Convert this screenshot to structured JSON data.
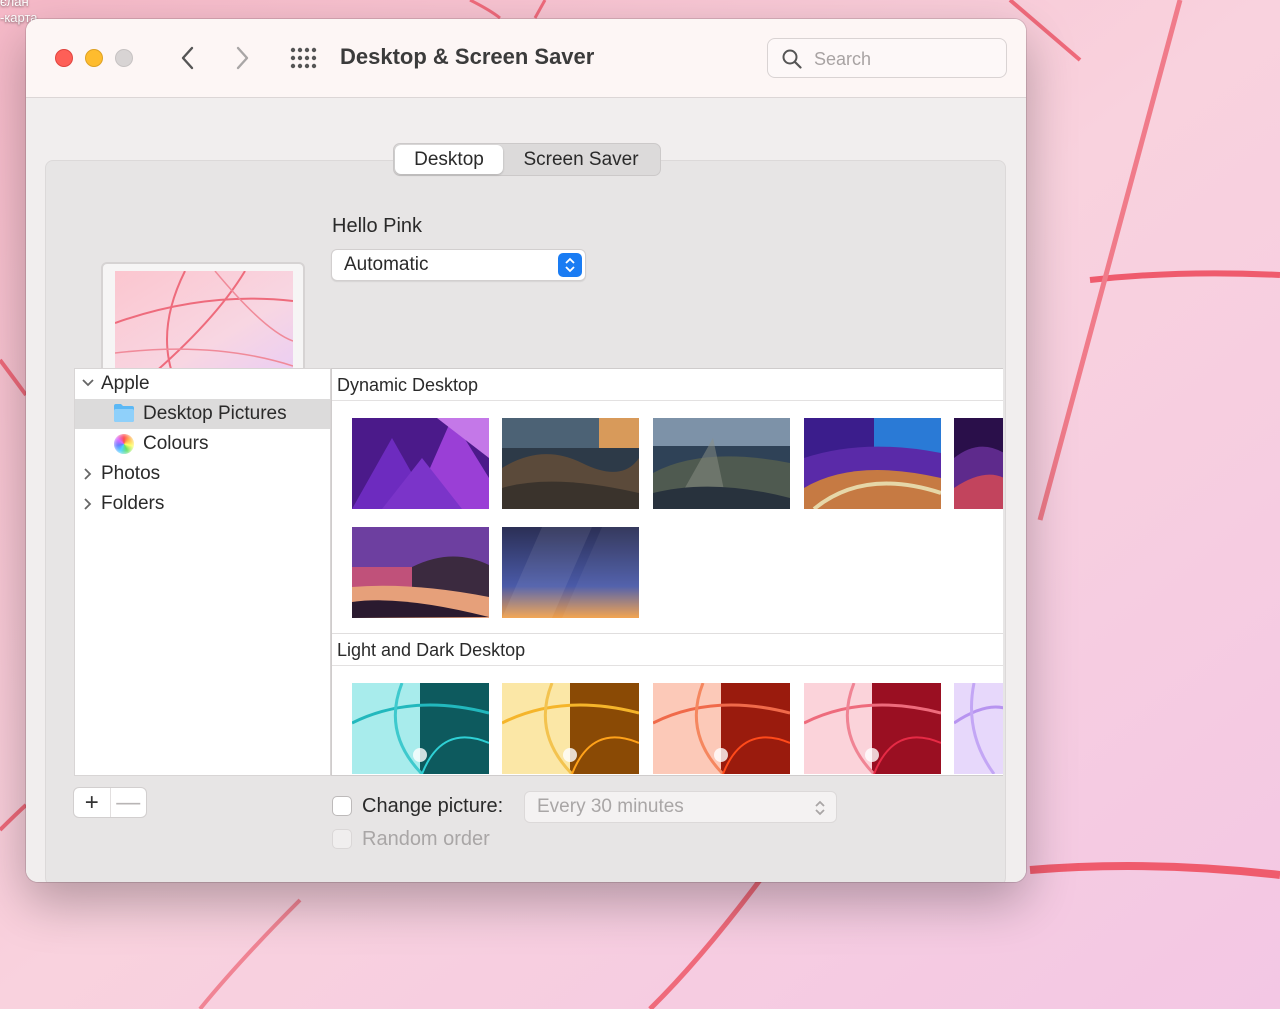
{
  "desktop_labels": [
    "єлан",
    "-карта"
  ],
  "window": {
    "title": "Desktop & Screen Saver",
    "search_placeholder": "Search"
  },
  "tabs": [
    {
      "label": "Desktop",
      "active": true
    },
    {
      "label": "Screen Saver",
      "active": false
    }
  ],
  "current": {
    "picture_name": "Hello Pink",
    "mode": "Automatic"
  },
  "sidebar": {
    "items": [
      {
        "label": "Apple",
        "expanded": true
      },
      {
        "label": "Desktop Pictures",
        "selected": true
      },
      {
        "label": "Colours"
      },
      {
        "label": "Photos",
        "expanded": false
      },
      {
        "label": "Folders",
        "expanded": false
      }
    ]
  },
  "sections": [
    {
      "title": "Dynamic Desktop",
      "count": 7
    },
    {
      "title": "Light and Dark Desktop",
      "count": 5
    }
  ],
  "options": {
    "change_picture_label": "Change picture:",
    "change_picture_checked": false,
    "interval": "Every 30 minutes",
    "random_order_label": "Random order",
    "random_order_checked": false
  },
  "buttons": {
    "add": "+",
    "remove": "—"
  },
  "colors": {
    "accent": "#1a7cf3",
    "close": "#fe5f57",
    "minimize": "#febc2e"
  }
}
